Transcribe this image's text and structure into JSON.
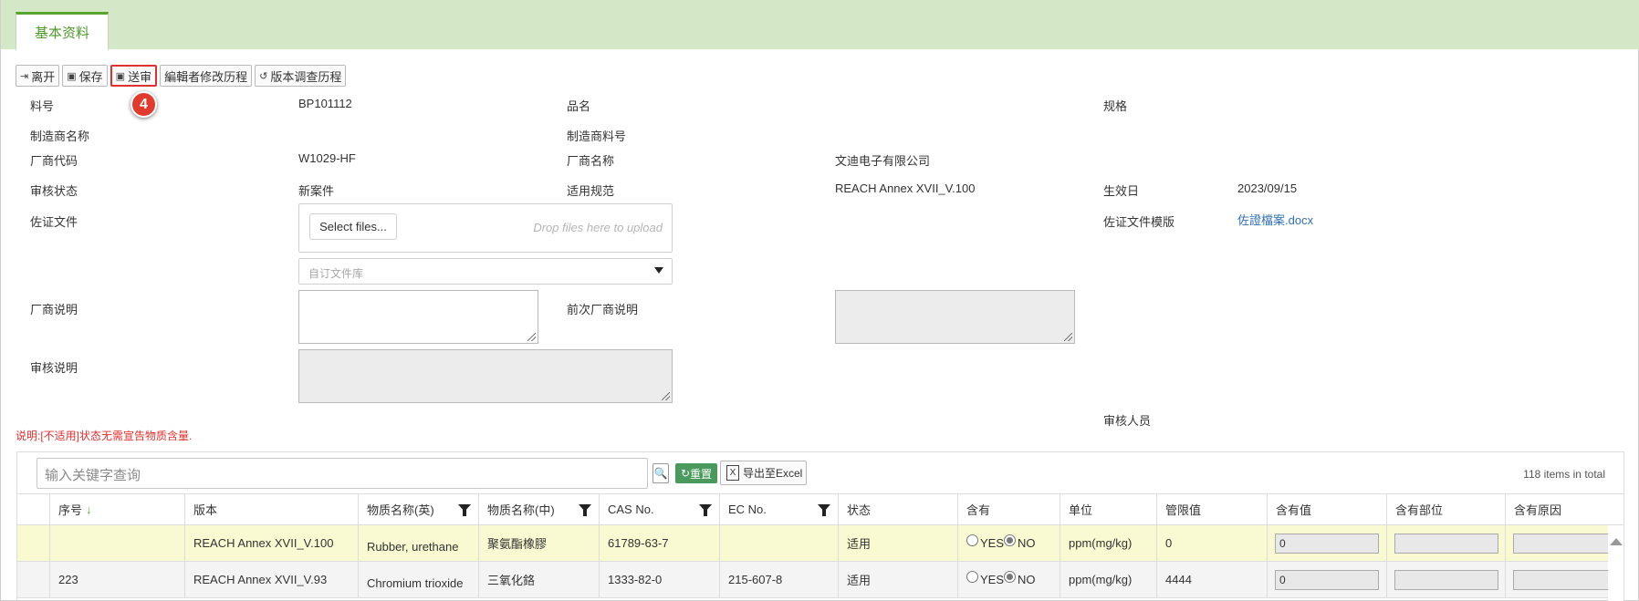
{
  "tab": {
    "label": "基本资料"
  },
  "toolbar": {
    "leave": "离开",
    "save": "保存",
    "submit": "送审",
    "editor_history": "編輯者修改历程",
    "version_history": "版本调查历程"
  },
  "step_badge": "4",
  "form": {
    "part_no_label": "料号",
    "part_no": "BP101112",
    "product_name_label": "品名",
    "spec_label": "规格",
    "manufacturer_name_label": "制造商名称",
    "manufacturer_part_label": "制造商料号",
    "vendor_code_label": "厂商代码",
    "vendor_code": "W1029-HF",
    "vendor_name_label": "厂商名称",
    "vendor_name": "文迪电子有限公司",
    "review_status_label": "审核状态",
    "review_status": "新案件",
    "regulation_label": "适用规范",
    "regulation": "REACH Annex XVII_V.100",
    "effective_date_label": "生效日",
    "effective_date": "2023/09/15",
    "docs_label": "佐证文件",
    "select_files": "Select files...",
    "drop_hint": "Drop files here to upload",
    "doc_library_placeholder": "自订文件库",
    "doc_template_label": "佐证文件模版",
    "doc_template_link": "佐證檔案.docx",
    "vendor_note_label": "厂商说明",
    "prev_vendor_note_label": "前次厂商说明",
    "review_note_label": "审核说明",
    "reviewer_label": "审核人员"
  },
  "note": "说明:[不适用]状态无需宣告物质含量.",
  "grid": {
    "search_placeholder": "输入关键字查询",
    "reset": "重置",
    "export": "导出至Excel",
    "total": "118 items in total",
    "columns": [
      "序号",
      "版本",
      "物质名称(英)",
      "物质名称(中)",
      "CAS No.",
      "EC No.",
      "状态",
      "含有",
      "单位",
      "管限值",
      "含有值",
      "含有部位",
      "含有原因"
    ],
    "yes": "YES",
    "no": "NO",
    "rows": [
      {
        "seq": "",
        "version": "REACH Annex XVII_V.100",
        "name_en": "Rubber, urethane",
        "name_zh": "聚氨酯橡膠",
        "cas": "61789-63-7",
        "ec": "",
        "status": "适用",
        "unit": "ppm(mg/kg)",
        "limit": "0",
        "value": "0"
      },
      {
        "seq": "223",
        "version": "REACH Annex XVII_V.93",
        "name_en": "Chromium trioxide",
        "name_zh": "三氧化鉻",
        "cas": "1333-82-0",
        "ec": "215-607-8",
        "status": "适用",
        "unit": "ppm(mg/kg)",
        "limit": "4444",
        "value": "0"
      }
    ]
  }
}
